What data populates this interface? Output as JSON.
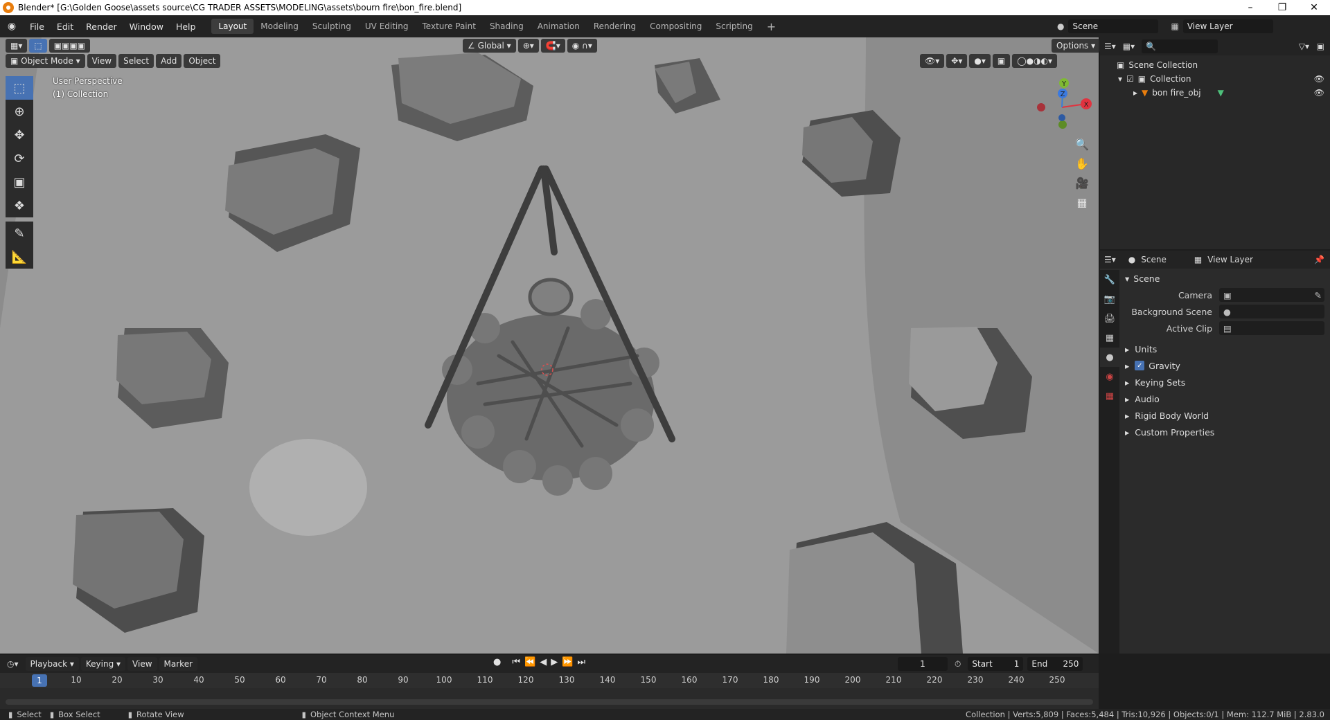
{
  "window": {
    "title": "Blender* [G:\\Golden Goose\\assets source\\CG TRADER ASSETS\\MODELING\\assets\\bourn fire\\bon_fire.blend]",
    "min": "–",
    "max": "❐",
    "close": "✕"
  },
  "menu": [
    "File",
    "Edit",
    "Render",
    "Window",
    "Help"
  ],
  "workspaces": [
    "Layout",
    "Modeling",
    "Sculpting",
    "UV Editing",
    "Texture Paint",
    "Shading",
    "Animation",
    "Rendering",
    "Compositing",
    "Scripting"
  ],
  "add_workspace": "+",
  "scene_field": "Scene",
  "view_layer_field": "View Layer",
  "viewport_header": {
    "mode": "Object Mode",
    "menus": [
      "View",
      "Select",
      "Add",
      "Object"
    ],
    "transform": "Global",
    "options": "Options"
  },
  "viewport_overlay": {
    "perspective": "User Perspective",
    "collection": "(1) Collection"
  },
  "gizmo": {
    "x": "X",
    "y": "Y",
    "z": "Z"
  },
  "outliner": {
    "root": "Scene Collection",
    "collection": "Collection",
    "object": "bon fire_obj"
  },
  "properties": {
    "tab_scene": "Scene",
    "tab_view_layer": "View Layer",
    "section": "Scene",
    "camera_label": "Camera",
    "background_label": "Background Scene",
    "clip_label": "Active Clip",
    "subsections": [
      "Units",
      "Gravity",
      "Keying Sets",
      "Audio",
      "Rigid Body World",
      "Custom Properties"
    ]
  },
  "timeline": {
    "menus": [
      "Playback",
      "Keying",
      "View",
      "Marker"
    ],
    "current_frame": "1",
    "start_label": "Start",
    "start": "1",
    "end_label": "End",
    "end": "250",
    "ticks": [
      "10",
      "20",
      "30",
      "40",
      "50",
      "60",
      "70",
      "80",
      "90",
      "100",
      "110",
      "120",
      "130",
      "140",
      "150",
      "160",
      "170",
      "180",
      "190",
      "200",
      "210",
      "220",
      "230",
      "240",
      "250"
    ],
    "playhead": "1"
  },
  "statusbar": {
    "select": "Select",
    "box_select": "Box Select",
    "rotate": "Rotate View",
    "context": "Object Context Menu",
    "stats": "Collection | Verts:5,809 | Faces:5,484 | Tris:10,926 | Objects:0/1 | Mem: 112.7 MiB | 2.83.0"
  },
  "colors": {
    "accent": "#4772b3",
    "x_axis": "#e0333f",
    "y_axis": "#7fba33",
    "z_axis": "#3b7ae0"
  }
}
